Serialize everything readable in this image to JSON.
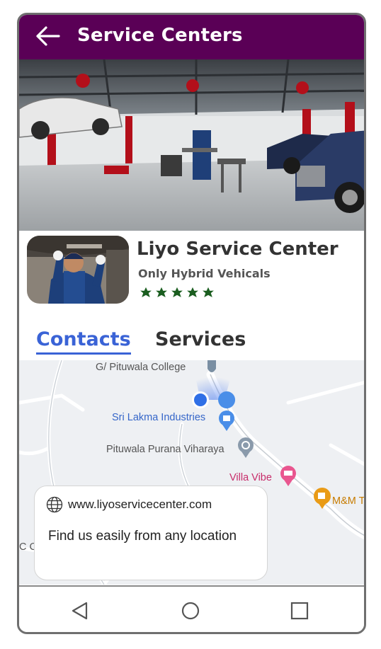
{
  "appbar": {
    "title": "Service Centers",
    "back_icon": "arrow-left-icon",
    "background": "#5a0056"
  },
  "center": {
    "name": "Liyo Service Center",
    "subtitle": "Only Hybrid Vehicals",
    "rating": 5,
    "star_color": "#1b5e20"
  },
  "tabs": [
    {
      "label": "Contacts",
      "active": true
    },
    {
      "label": "Services",
      "active": false
    }
  ],
  "map": {
    "labels": {
      "college": "G/ Pituwala College",
      "industries": "Sri Lakma Industries",
      "vihara": "Pituwala Purana Viharaya",
      "villa": "Villa Vibe",
      "mm": "M&M T",
      "edge_c": "C C"
    }
  },
  "info_card": {
    "website": "www.liyoservicecenter.com",
    "text": "Find us easily from any location"
  },
  "navbar": {
    "back": "triangle-back-icon",
    "home": "circle-home-icon",
    "recents": "square-recents-icon"
  },
  "accent": "#3a63d6"
}
